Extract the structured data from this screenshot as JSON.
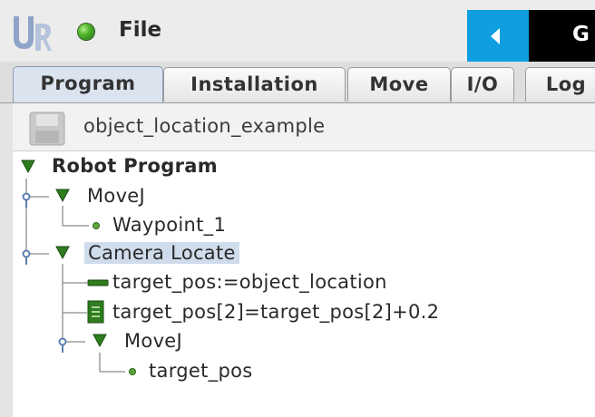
{
  "header": {
    "logo": "UR",
    "status_icon": "green-globe-icon",
    "file_label": "File",
    "back_icon": "triangle-left-icon",
    "right_panel_text": "G"
  },
  "tabs": [
    {
      "label": "Program",
      "active": true
    },
    {
      "label": "Installation",
      "active": false
    },
    {
      "label": "Move",
      "active": false
    },
    {
      "label": "I/O",
      "active": false
    },
    {
      "label": "Log",
      "active": false
    }
  ],
  "program": {
    "name": "object_location_example",
    "save_icon": "floppy-disk-icon"
  },
  "tree": {
    "root": "Robot Program",
    "movej_1": "MoveJ",
    "waypoint_1": "Waypoint_1",
    "camera_locate": "Camera Locate",
    "assign": "target_pos:=object_location",
    "script": "target_pos[2]=target_pos[2]+0.2",
    "movej_2": "MoveJ",
    "waypoint_2": "target_pos"
  },
  "colors": {
    "accent_blue": "#0f9fe0",
    "tree_lines": "#8c8c8c",
    "selection": "#cfdcec",
    "tree_green": "#2e7d1e"
  }
}
